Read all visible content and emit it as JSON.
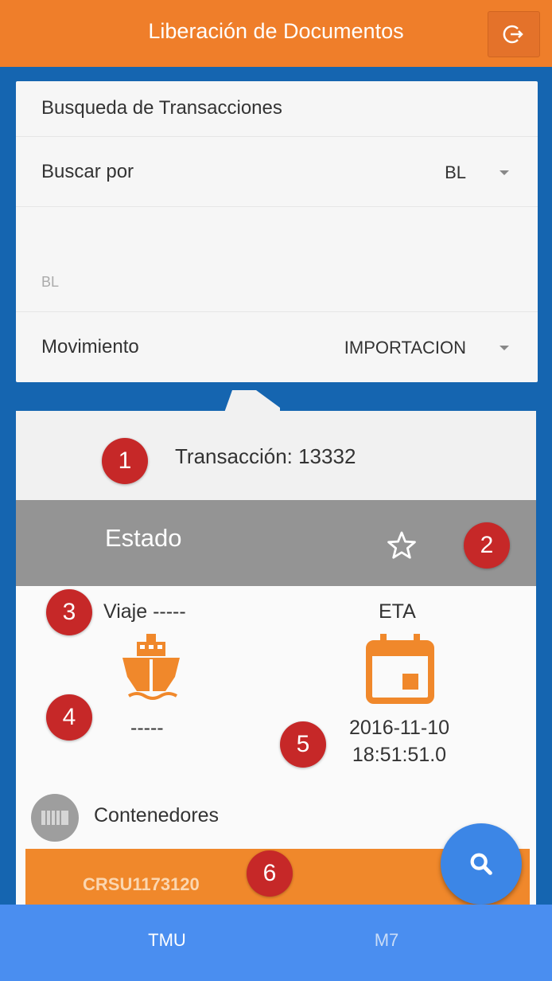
{
  "header": {
    "title": "Liberación de Documentos",
    "logout_icon": "logout-icon"
  },
  "search": {
    "title": "Busqueda de Transacciones",
    "buscar_por_label": "Buscar por",
    "buscar_por_value": "BL",
    "bl_placeholder": "BL",
    "movimiento_label": "Movimiento",
    "movimiento_value": "IMPORTACION"
  },
  "result": {
    "transaccion": "Transacción: 13332",
    "estado_label": "Estado",
    "viaje": "Viaje -----",
    "eta_label": "ETA",
    "ship_value": "-----",
    "eta_date": "2016-11-10",
    "eta_time": "18:51:51.0",
    "contenedores_label": "Contenedores",
    "container_id": "CRSU1173120"
  },
  "bottom_nav": {
    "tabs": [
      "TMU",
      "M7"
    ]
  },
  "badges": [
    "1",
    "2",
    "3",
    "4",
    "5",
    "6"
  ],
  "colors": {
    "header": "#ef7e2a",
    "background": "#1565b0",
    "estado": "#949494",
    "accent_orange": "#f0882b",
    "fab": "#3c86e6",
    "badge": "#c62828"
  }
}
